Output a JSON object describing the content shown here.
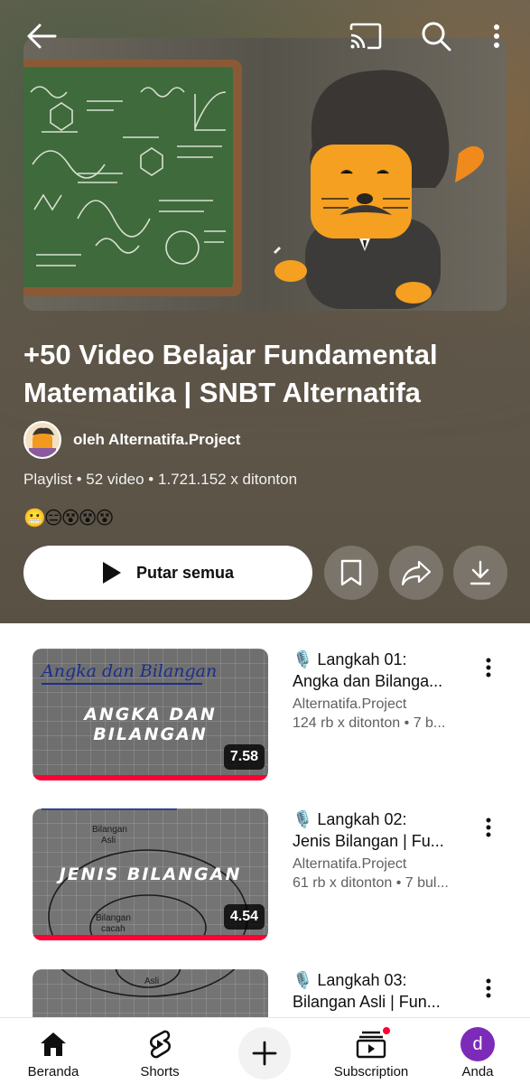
{
  "colors": {
    "hero_bg": "#5f5749",
    "accent_red": "#ff0033",
    "avatar_purple": "#7b2bb8"
  },
  "top_bar": {
    "back_icon": "arrow-left-icon",
    "cast_icon": "cast-icon",
    "search_icon": "search-icon",
    "more_icon": "more-vertical-icon"
  },
  "playlist": {
    "title": "+50 Video Belajar Fundamental Matematika | SNBT Alternatifa",
    "channel": "oleh Alternatifa.Project",
    "meta": {
      "type": "Playlist",
      "video_count": "52 video",
      "views": "1.721.152 x ditonton"
    },
    "emojis": "😬😑😵😵😵",
    "play_all_label": "Putar semua",
    "actions": [
      "save-icon",
      "share-icon",
      "download-icon"
    ]
  },
  "videos": [
    {
      "title_line1": "🎙️ Langkah 01:",
      "title_line2": "Angka dan Bilanga...",
      "channel": "Alternatifa.Project",
      "stats": "124 rb x ditonton • 7 b...",
      "duration": "7.58",
      "thumb_heading": "Angka dan Bilangan",
      "thumb_text": "ANGKA DAN BILANGAN"
    },
    {
      "title_line1": "🎙️ Langkah 02:",
      "title_line2": "Jenis Bilangan | Fu...",
      "channel": "Alternatifa.Project",
      "stats": "61 rb x ditonton • 7 bul...",
      "duration": "4.54",
      "thumb_text": "JENIS BILANGAN",
      "thumb_small_1": "Bilangan",
      "thumb_small_2": "Asli",
      "thumb_small_3": "Bilangan",
      "thumb_small_4": "cacah"
    },
    {
      "title_line1": "🎙️ Langkah 03:",
      "title_line2": "Bilangan Asli | Fun...",
      "thumb_small": "Asli"
    }
  ],
  "bottom_nav": {
    "items": [
      {
        "label": "Beranda",
        "icon": "home-icon"
      },
      {
        "label": "Shorts",
        "icon": "shorts-icon"
      },
      {
        "label": "",
        "icon": "create-plus-icon"
      },
      {
        "label": "Subscription",
        "icon": "subscriptions-icon"
      },
      {
        "label": "Anda",
        "icon": "avatar",
        "avatar_letter": "d"
      }
    ]
  }
}
